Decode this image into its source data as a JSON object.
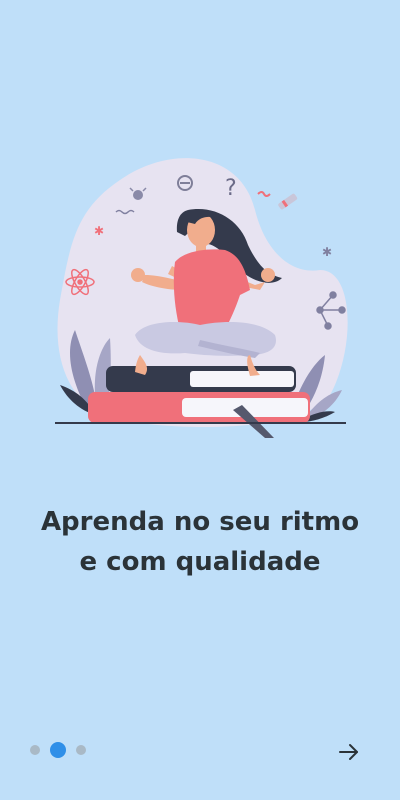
{
  "onboarding": {
    "headline_line1": "Aprenda no seu ritmo",
    "headline_line2": "e com qualidade",
    "illustration": "meditating-woman-on-books",
    "pagination": {
      "total": 3,
      "current": 2
    },
    "next_icon": "arrow-right-icon"
  },
  "colors": {
    "background": "#bfdff9",
    "text": "#2b3338",
    "accent": "#2f8fe8",
    "dot_inactive": "#a9b9c6",
    "blob": "#e7e3f1",
    "coral": "#f0707a",
    "dark": "#343a4c"
  }
}
